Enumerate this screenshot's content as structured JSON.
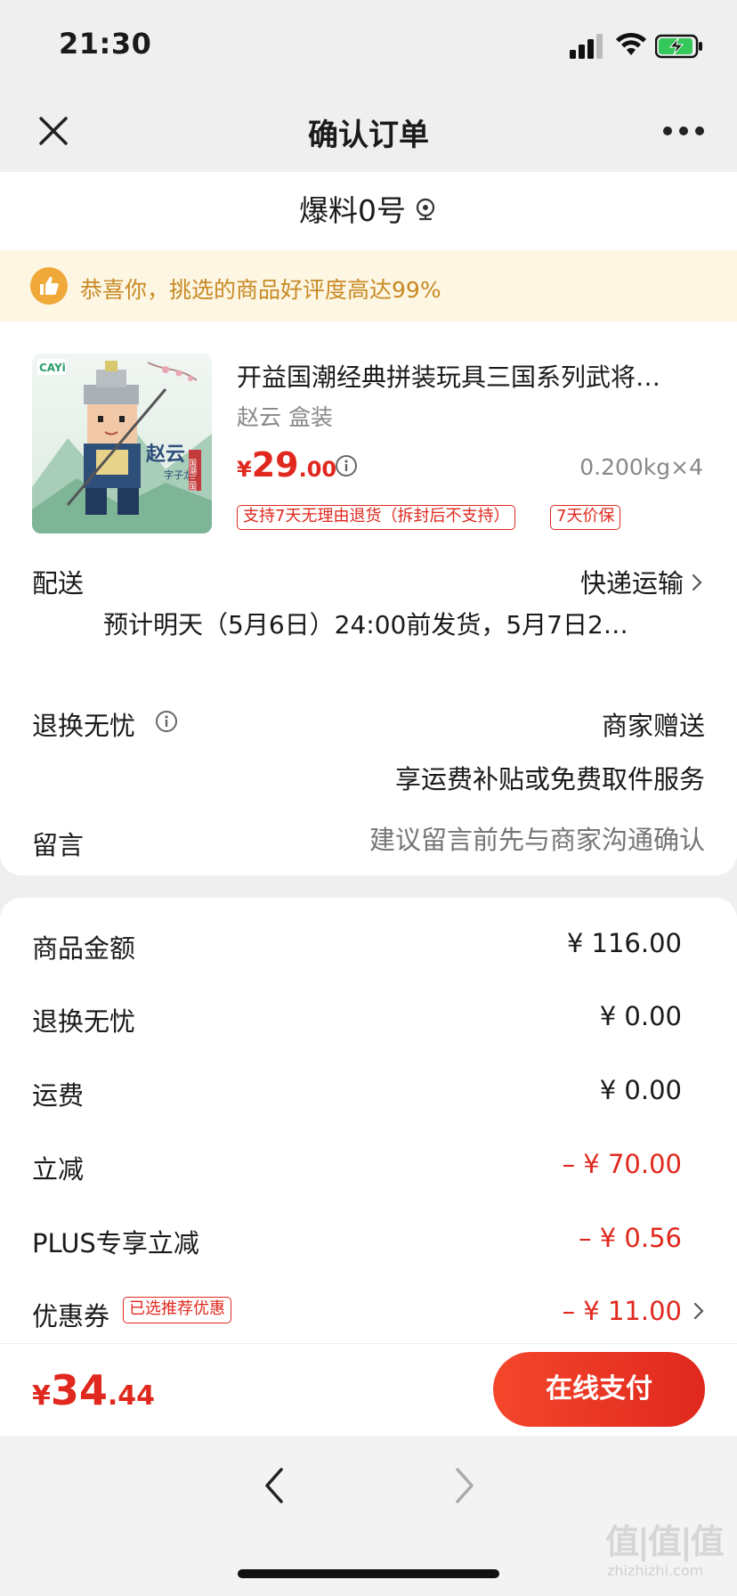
{
  "status_bar": {
    "time": "21:30"
  },
  "nav": {
    "title": "确认订单"
  },
  "address": {
    "name": "爆料0号"
  },
  "banner": {
    "text": "恭喜你，挑选的商品好评度高达99%"
  },
  "product": {
    "title": "开益国潮经典拼装玩具三国系列武将…",
    "spec": "赵云 盒装",
    "price_currency": "¥",
    "price_int": "29",
    "price_dec": ".00",
    "weight_qty": "0.200kg×4",
    "tags": [
      "支持7天无理由退货（拆封后不支持）",
      "7天价保"
    ],
    "image_text": {
      "brand": "CAYi",
      "name": "赵云",
      "subtitle": "字子龙",
      "series": "国潮三国"
    }
  },
  "shipping": {
    "label": "配送",
    "value": "快递运输",
    "estimate": "预计明天（5月6日）24:00前发货，5月7日2…"
  },
  "worry_free": {
    "label": "退换无忧",
    "value": "商家赠送",
    "sub": "享运费补贴或免费取件服务"
  },
  "message": {
    "label": "留言",
    "placeholder": "建议留言前先与商家沟通确认"
  },
  "summary": {
    "rows": [
      {
        "label": "商品金额",
        "value": "¥ 116.00"
      },
      {
        "label": "退换无忧",
        "value": "¥ 0.00"
      },
      {
        "label": "运费",
        "value": "¥ 0.00"
      },
      {
        "label": "立减",
        "value": "– ¥ 70.00"
      },
      {
        "label": "PLUS专享立减",
        "value": "– ¥ 0.56"
      },
      {
        "label": "优惠券",
        "value": "– ¥ 11.00",
        "tag": "已选推荐优惠"
      }
    ]
  },
  "pay": {
    "total_currency": "¥",
    "total_int": "34",
    "total_dec": ".44",
    "button_label": "在线支付"
  },
  "watermark": {
    "main": "值|值|值",
    "sub": "zhizhizhi.com"
  },
  "colors": {
    "accent": "#e0281e",
    "banner_bg": "#fdf6e3",
    "banner_text": "#c88a25"
  }
}
